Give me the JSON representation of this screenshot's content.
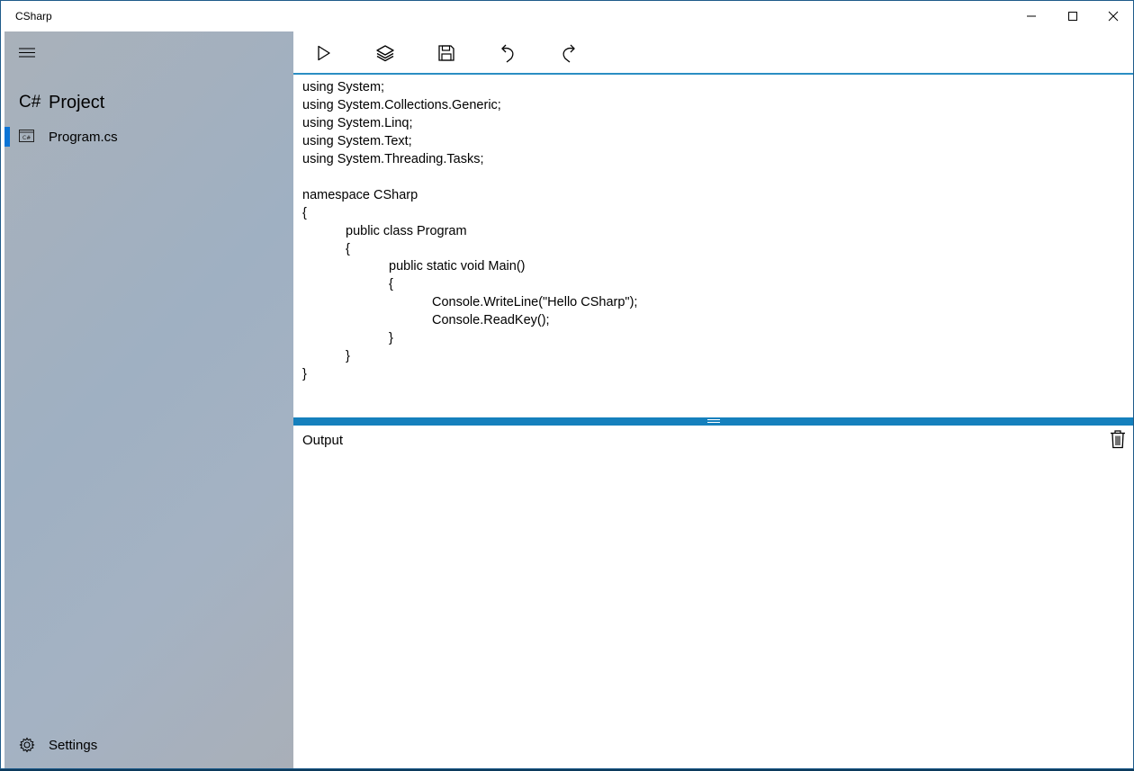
{
  "window": {
    "title": "CSharp",
    "controls": [
      "minimize-icon",
      "maximize-icon",
      "close-icon"
    ]
  },
  "sidebar": {
    "menu_icon": "hamburger-icon",
    "project_glyph": "C#",
    "project_title": "Project",
    "files": [
      {
        "label": "Program.cs",
        "icon": "cs-file-icon",
        "selected": true
      }
    ],
    "settings_label": "Settings",
    "settings_icon": "gear-icon"
  },
  "toolbar": {
    "buttons": [
      {
        "name": "run",
        "icon": "play-icon"
      },
      {
        "name": "build",
        "icon": "layers-icon"
      },
      {
        "name": "save",
        "icon": "save-icon"
      },
      {
        "name": "undo",
        "icon": "undo-icon"
      },
      {
        "name": "redo",
        "icon": "redo-icon"
      }
    ]
  },
  "editor": {
    "lines": [
      "using System;",
      "using System.Collections.Generic;",
      "using System.Linq;",
      "using System.Text;",
      "using System.Threading.Tasks;",
      "",
      "namespace CSharp",
      "{",
      "public class Program",
      "{",
      "public static void Main()",
      "{",
      "Console.WriteLine(\"Hello CSharp\");",
      "Console.ReadKey();",
      "}",
      "}",
      "}"
    ]
  },
  "output": {
    "label": "Output",
    "clear_icon": "trash-icon"
  },
  "colors": {
    "accent": "#1580bd",
    "selection": "#0a74d6"
  }
}
